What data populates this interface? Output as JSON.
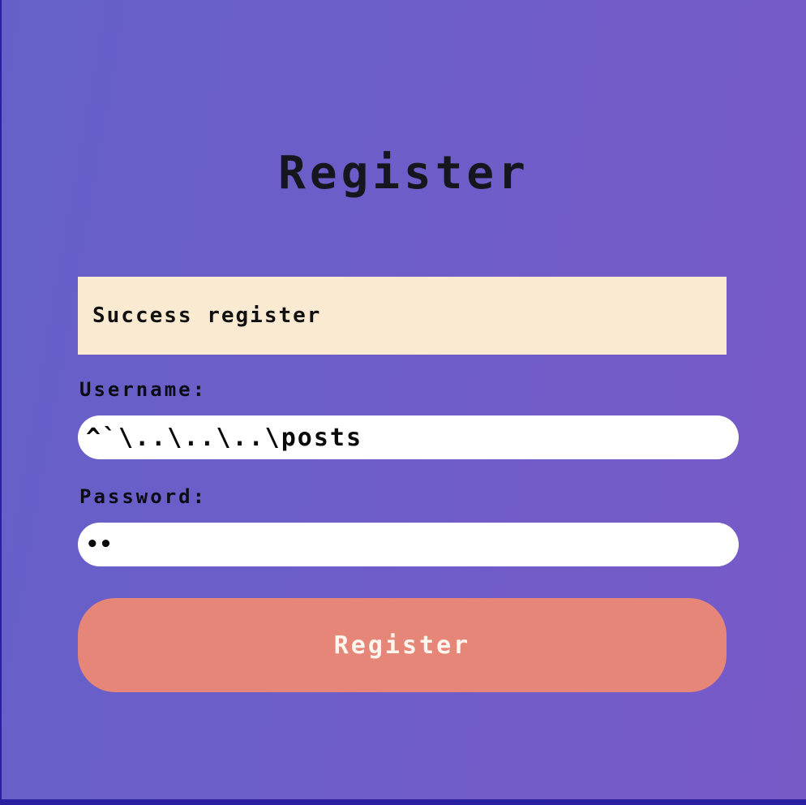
{
  "form": {
    "title": "Register",
    "alert_message": "Success register",
    "username_label": "Username:",
    "username_value": "^`\\..\\..\\..\\posts",
    "password_label": "Password:",
    "password_value": "••",
    "submit_label": "Register"
  },
  "colors": {
    "background_start": "#6560c9",
    "background_end": "#785ac7",
    "alert_background": "#fbead2",
    "button_background": "#e68679",
    "button_text": "#fdf6ee",
    "title_text": "#16161f"
  }
}
